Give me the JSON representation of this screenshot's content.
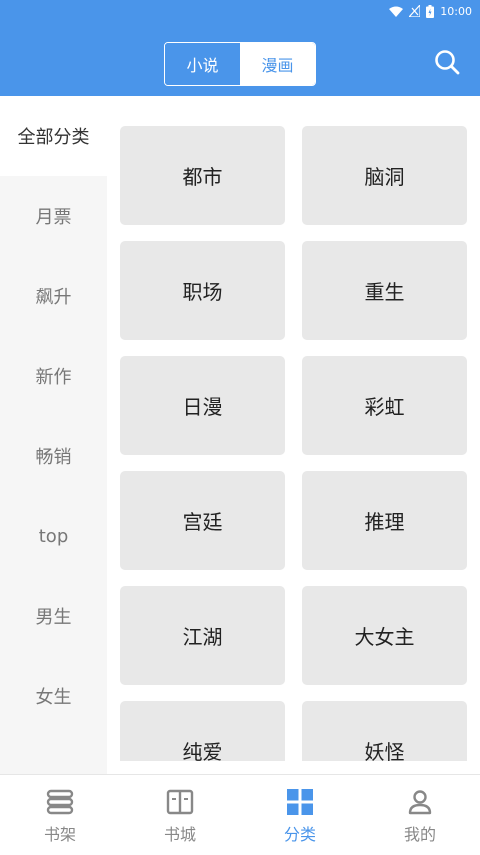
{
  "status_bar": {
    "time": "10:00"
  },
  "header": {
    "tabs": [
      {
        "label": "小说",
        "active": true
      },
      {
        "label": "漫画",
        "active": false
      }
    ],
    "search_icon": "search-icon"
  },
  "sidebar": {
    "items": [
      {
        "label": "全部分类",
        "selected": true
      },
      {
        "label": "月票"
      },
      {
        "label": "飙升"
      },
      {
        "label": "新作"
      },
      {
        "label": "畅销"
      },
      {
        "label": "top"
      },
      {
        "label": "男生"
      },
      {
        "label": "女生"
      }
    ]
  },
  "categories": [
    "都市",
    "脑洞",
    "职场",
    "重生",
    "日漫",
    "彩虹",
    "宫廷",
    "推理",
    "江湖",
    "大女主",
    "纯爱",
    "妖怪"
  ],
  "tabbar": {
    "items": [
      {
        "label": "书架",
        "icon": "bookshelf-icon"
      },
      {
        "label": "书城",
        "icon": "book-icon"
      },
      {
        "label": "分类",
        "icon": "category-grid-icon",
        "active": true
      },
      {
        "label": "我的",
        "icon": "profile-icon"
      }
    ]
  },
  "colors": {
    "primary": "#4a95ea",
    "card": "#e8e8e8",
    "sidebar": "#f6f6f6"
  }
}
